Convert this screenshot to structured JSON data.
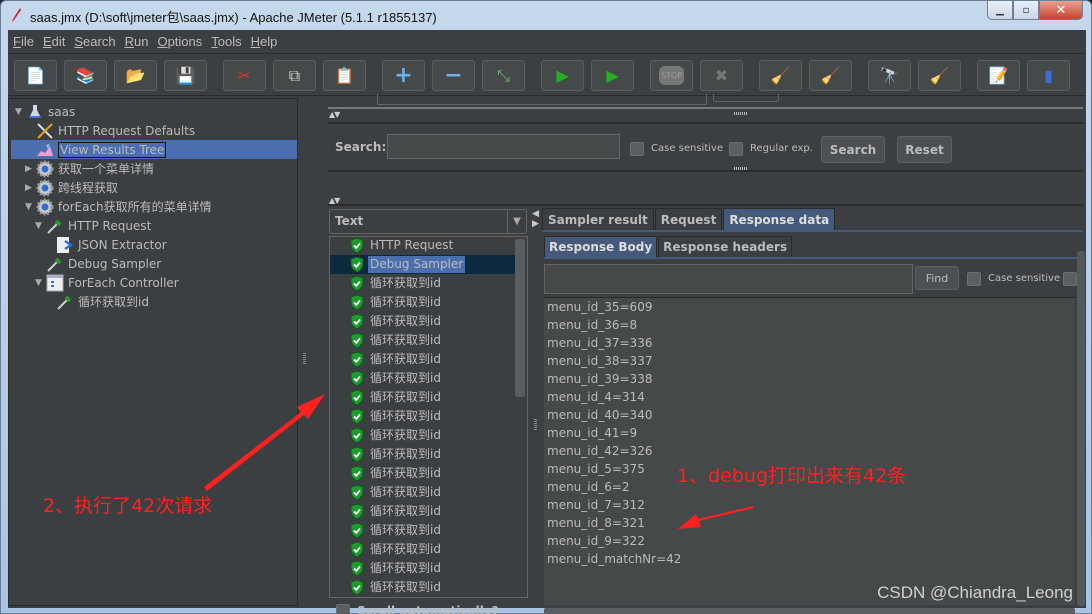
{
  "window": {
    "title": "saas.jmx (D:\\soft\\jmeter包\\saas.jmx) - Apache JMeter (5.1.1 r1855137)",
    "controls": {
      "minimize": "▁",
      "maximize": "▫",
      "close": "✕"
    }
  },
  "menubar": [
    {
      "key": "F",
      "rest": "ile"
    },
    {
      "key": "E",
      "rest": "dit"
    },
    {
      "key": "S",
      "rest": "earch"
    },
    {
      "key": "R",
      "rest": "un"
    },
    {
      "key": "O",
      "rest": "ptions"
    },
    {
      "key": "T",
      "rest": "ools"
    },
    {
      "key": "H",
      "rest": "elp"
    }
  ],
  "toolbar": [
    {
      "name": "new",
      "glyph": "📄"
    },
    {
      "name": "templates",
      "glyph": "📚"
    },
    {
      "name": "open",
      "glyph": "📂"
    },
    {
      "name": "save",
      "glyph": "💾"
    },
    {
      "name": "cut",
      "glyph": "✂"
    },
    {
      "name": "copy",
      "glyph": "⧉"
    },
    {
      "name": "paste",
      "glyph": "📋"
    },
    {
      "name": "expand",
      "glyph": "+"
    },
    {
      "name": "collapse",
      "glyph": "−"
    },
    {
      "name": "toggle",
      "glyph": "⤡"
    },
    {
      "name": "start",
      "glyph": "▶"
    },
    {
      "name": "start-no-pauses",
      "glyph": "▶"
    },
    {
      "name": "stop",
      "glyph": "STOP"
    },
    {
      "name": "shutdown",
      "glyph": "✖"
    },
    {
      "name": "clear",
      "glyph": "🧹"
    },
    {
      "name": "clear-all",
      "glyph": "🧹"
    },
    {
      "name": "search",
      "glyph": "🔭"
    },
    {
      "name": "reset-search",
      "glyph": "🧹"
    },
    {
      "name": "function-helper",
      "glyph": "📝"
    },
    {
      "name": "help",
      "glyph": "▮"
    }
  ],
  "tree": [
    {
      "label": "saas",
      "level": 0,
      "toggle": "▼",
      "icon": "flask"
    },
    {
      "label": "HTTP Request Defaults",
      "level": 1,
      "toggle": "",
      "icon": "tools"
    },
    {
      "label": "View Results Tree",
      "level": 1,
      "toggle": "",
      "icon": "graph",
      "selected": true
    },
    {
      "label": "获取一个菜单详情",
      "level": 1,
      "toggle": "▶",
      "icon": "gear"
    },
    {
      "label": "跨线程获取",
      "level": 1,
      "toggle": "▶",
      "icon": "gear"
    },
    {
      "label": "forEach获取所有的菜单详情",
      "level": 1,
      "toggle": "▼",
      "icon": "gear"
    },
    {
      "label": "HTTP Request",
      "level": 2,
      "toggle": "▼",
      "icon": "pipette"
    },
    {
      "label": "JSON Extractor",
      "level": 3,
      "toggle": "",
      "icon": "extractor"
    },
    {
      "label": "Debug Sampler",
      "level": 2,
      "toggle": "",
      "icon": "pipette"
    },
    {
      "label": "ForEach Controller",
      "level": 2,
      "toggle": "▼",
      "icon": "controller"
    },
    {
      "label": "循环获取到id",
      "level": 3,
      "toggle": "",
      "icon": "pipette"
    }
  ],
  "search": {
    "label": "Search:",
    "value": "",
    "case_sensitive": "Case sensitive",
    "regular_exp": "Regular exp.",
    "search_button": "Search",
    "reset_button": "Reset"
  },
  "renderer": {
    "selected": "Text"
  },
  "results": [
    {
      "label": "HTTP Request",
      "status": "success"
    },
    {
      "label": "Debug Sampler",
      "status": "success",
      "selected": true
    },
    {
      "label": "循环获取到id",
      "status": "success"
    },
    {
      "label": "循环获取到id",
      "status": "success"
    },
    {
      "label": "循环获取到id",
      "status": "success"
    },
    {
      "label": "循环获取到id",
      "status": "success"
    },
    {
      "label": "循环获取到id",
      "status": "success"
    },
    {
      "label": "循环获取到id",
      "status": "success"
    },
    {
      "label": "循环获取到id",
      "status": "success"
    },
    {
      "label": "循环获取到id",
      "status": "success"
    },
    {
      "label": "循环获取到id",
      "status": "success"
    },
    {
      "label": "循环获取到id",
      "status": "success"
    },
    {
      "label": "循环获取到id",
      "status": "success"
    },
    {
      "label": "循环获取到id",
      "status": "success"
    },
    {
      "label": "循环获取到id",
      "status": "success"
    },
    {
      "label": "循环获取到id",
      "status": "success"
    },
    {
      "label": "循环获取到id",
      "status": "success"
    },
    {
      "label": "循环获取到id",
      "status": "success"
    },
    {
      "label": "循环获取到id",
      "status": "success"
    },
    {
      "label": "循环获取到id",
      "status": "success"
    }
  ],
  "scroll_automatically": "Scroll automatically?",
  "tabs": [
    {
      "label": "Sampler result"
    },
    {
      "label": "Request"
    },
    {
      "label": "Response data",
      "active": true
    }
  ],
  "subtabs": [
    {
      "label": "Response Body",
      "active": true
    },
    {
      "label": "Response headers"
    }
  ],
  "find": {
    "value": "",
    "button": "Find",
    "case_sensitive": "Case sensitive"
  },
  "response_lines": [
    "menu_id_35=609",
    "menu_id_36=8",
    "menu_id_37=336",
    "menu_id_38=337",
    "menu_id_39=338",
    "menu_id_4=314",
    "menu_id_40=340",
    "menu_id_41=9",
    "menu_id_42=326",
    "menu_id_5=375",
    "menu_id_6=2",
    "menu_id_7=312",
    "menu_id_8=321",
    "menu_id_9=322",
    "menu_id_matchNr=42"
  ],
  "annotations": {
    "note1": "1、debug打印出来有42条",
    "note2": "2、执行了42次请求",
    "color": "#ff2020"
  },
  "watermark": "CSDN @Chiandra_Leong"
}
